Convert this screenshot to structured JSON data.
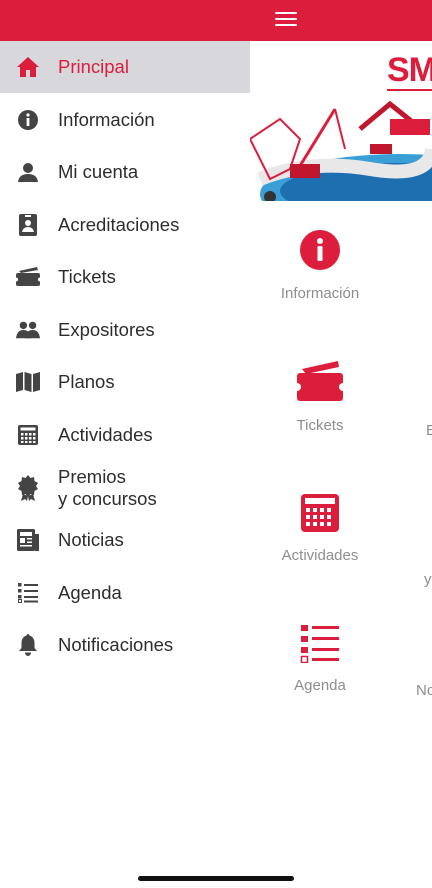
{
  "colors": {
    "brand": "#dc1e3c",
    "active_bg": "#d8d8dc",
    "menu_text": "#2d2d2d",
    "tile_text": "#8e8e8e",
    "icon_gray": "#444444"
  },
  "topbar": {
    "menu_icon": "hamburger-icon"
  },
  "main": {
    "logo_text": "SM",
    "tiles": [
      {
        "label": "Información",
        "icon": "info-icon"
      },
      {
        "label": "Tickets",
        "icon": "ticket-icon"
      },
      {
        "label": "Actividades",
        "icon": "calendar-icon"
      },
      {
        "label": "Agenda",
        "icon": "list-icon"
      }
    ],
    "clipped_labels": [
      "E",
      "y",
      "No"
    ]
  },
  "drawer": {
    "items": [
      {
        "label": "Principal",
        "icon": "home-icon",
        "active": true
      },
      {
        "label": "Información",
        "icon": "info-icon"
      },
      {
        "label": "Mi cuenta",
        "icon": "user-icon"
      },
      {
        "label": "Acreditaciones",
        "icon": "badge-icon"
      },
      {
        "label": "Tickets",
        "icon": "ticket-icon"
      },
      {
        "label": "Expositores",
        "icon": "group-icon"
      },
      {
        "label": "Planos",
        "icon": "map-icon"
      },
      {
        "label": "Actividades",
        "icon": "calendar-icon"
      },
      {
        "label": "Premios\ny concursos",
        "icon": "award-icon"
      },
      {
        "label": "Noticias",
        "icon": "newspaper-icon"
      },
      {
        "label": "Agenda",
        "icon": "list-icon"
      },
      {
        "label": "Notificaciones",
        "icon": "bell-icon"
      }
    ]
  }
}
